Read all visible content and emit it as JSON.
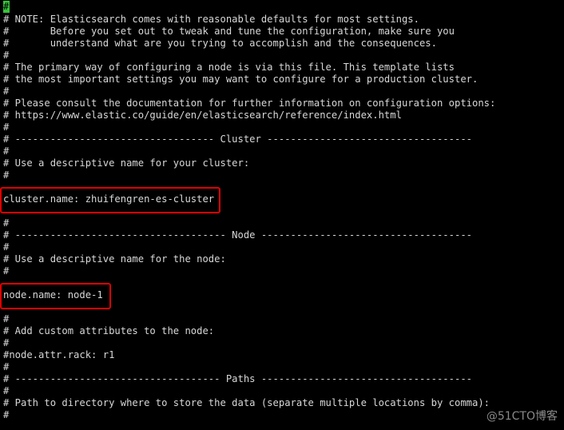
{
  "cursor_char": "#",
  "lines": [
    "",
    "# NOTE: Elasticsearch comes with reasonable defaults for most settings.",
    "#       Before you set out to tweak and tune the configuration, make sure you",
    "#       understand what are you trying to accomplish and the consequences.",
    "#",
    "# The primary way of configuring a node is via this file. This template lists",
    "# the most important settings you may want to configure for a production cluster.",
    "#",
    "# Please consult the documentation for further information on configuration options:",
    "# https://www.elastic.co/guide/en/elasticsearch/reference/index.html",
    "#",
    "# ---------------------------------- Cluster -----------------------------------",
    "#",
    "# Use a descriptive name for your cluster:",
    "#",
    "",
    "cluster.name: zhuifengren-es-cluster",
    "",
    "#",
    "# ------------------------------------ Node ------------------------------------",
    "#",
    "# Use a descriptive name for the node:",
    "#",
    "",
    "node.name: node-1",
    "",
    "#",
    "# Add custom attributes to the node:",
    "#",
    "#node.attr.rack: r1",
    "#",
    "# ----------------------------------- Paths ------------------------------------",
    "#",
    "# Path to directory where to store the data (separate multiple locations by comma):",
    "#"
  ],
  "highlights": [
    "cluster.name",
    "node.name"
  ],
  "colors": {
    "background": "#000000",
    "text": "#d7d7d7",
    "cursor": "#36c43a",
    "highlight_border": "#e00000"
  },
  "watermark": "@51CTO博客"
}
